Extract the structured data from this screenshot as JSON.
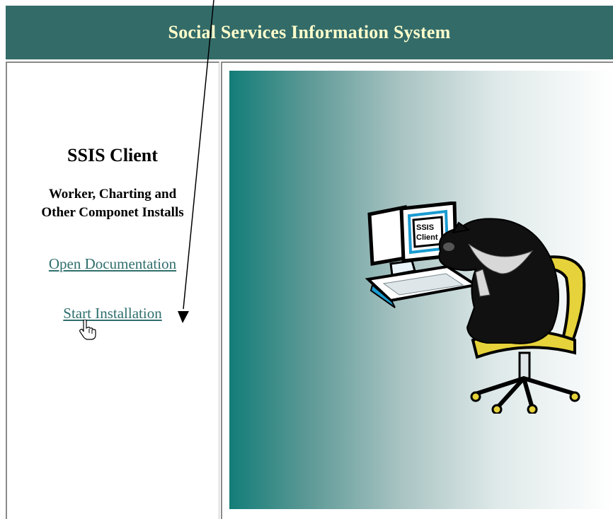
{
  "header": {
    "title": "Social Services Information System"
  },
  "left_panel": {
    "title": "SSIS Client",
    "subtitle_line1": "Worker, Charting and",
    "subtitle_line2": "Other Componet Installs",
    "links": {
      "documentation": "Open Documentation",
      "installation": "Start Installation"
    }
  },
  "illustration": {
    "screen_line1": "SSIS",
    "screen_line2": "Client",
    "icon": "bear-at-computer-icon"
  },
  "colors": {
    "header_bg": "#336b69",
    "header_text": "#ffffcc",
    "link": "#2f6f6d",
    "gradient_start": "#137d78"
  }
}
